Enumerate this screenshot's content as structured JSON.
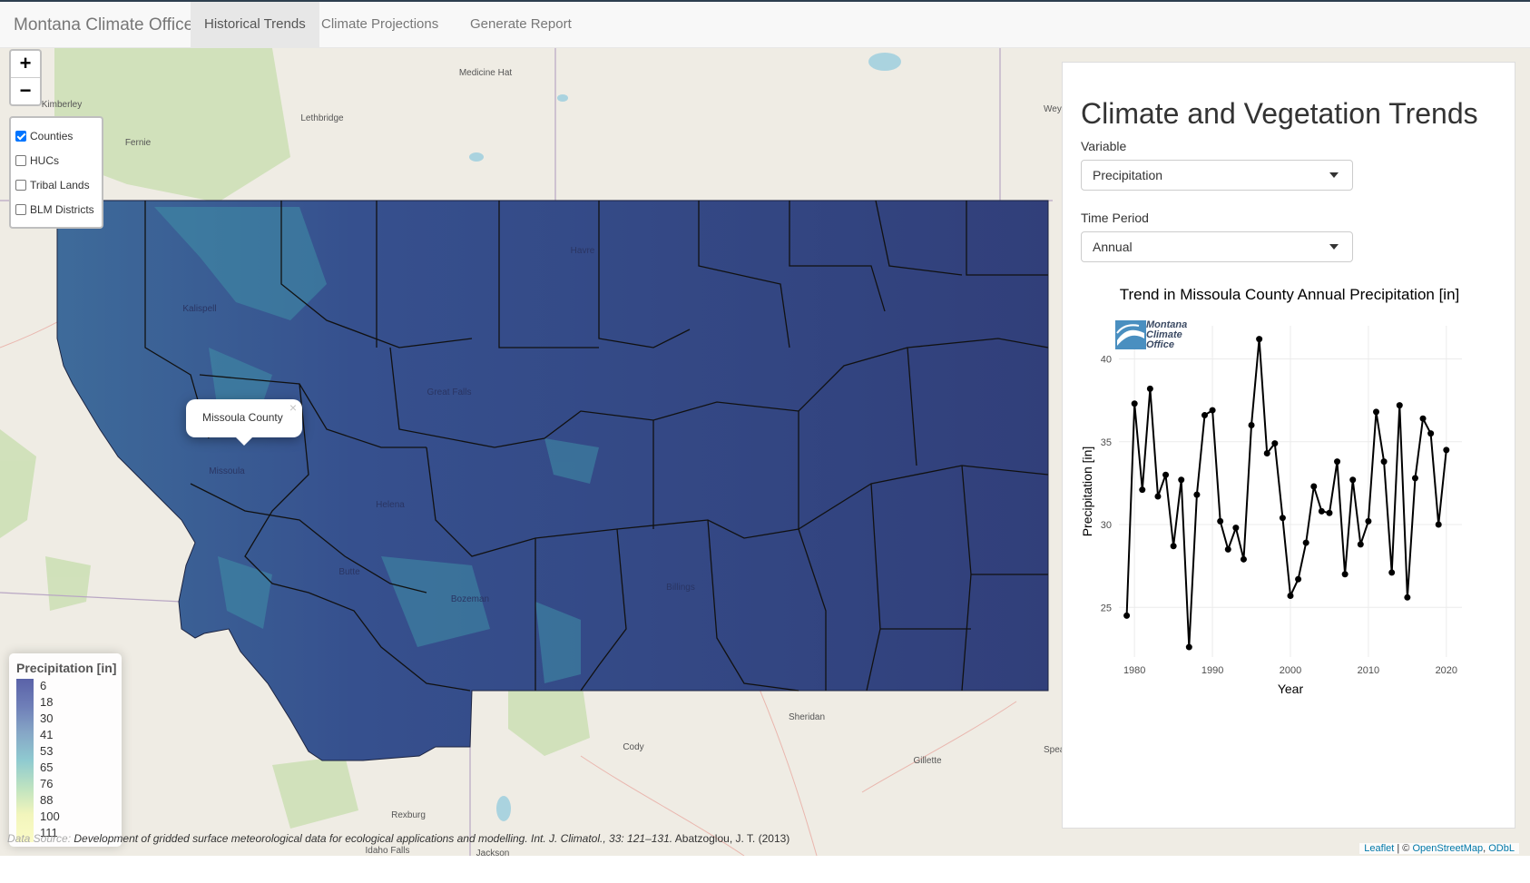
{
  "navbar": {
    "brand": "Montana Climate Office",
    "tabs": [
      {
        "label": "Historical Trends",
        "active": true
      },
      {
        "label": "Climate Projections",
        "active": false
      },
      {
        "label": "Generate Report",
        "active": false
      }
    ]
  },
  "map": {
    "zoom_in": "+",
    "zoom_out": "−",
    "layers": [
      {
        "label": "Counties",
        "checked": true
      },
      {
        "label": "HUCs",
        "checked": false
      },
      {
        "label": "Tribal Lands",
        "checked": false
      },
      {
        "label": "BLM Districts",
        "checked": false
      }
    ],
    "popup": {
      "text": "Missoula County",
      "close": "×"
    },
    "place_labels": [
      "Medicine Hat",
      "Lethbridge",
      "Kimberley",
      "Fernie",
      "Kalispell",
      "Great Falls",
      "Havre",
      "Missoula",
      "Helena",
      "Butte",
      "Bozeman",
      "Billings",
      "Sheridan",
      "Cody",
      "Gillette",
      "Rexburg",
      "Idaho Falls",
      "Jackson",
      "Wey",
      "Spea"
    ],
    "legend": {
      "title": "Precipitation [in]",
      "ticks": [
        "6",
        "18",
        "30",
        "41",
        "53",
        "65",
        "76",
        "88",
        "100",
        "111"
      ],
      "colors": [
        "#5a62a8",
        "#6f7fb8",
        "#86a6c6",
        "#8fcad0",
        "#bfe3c0",
        "#f2f5bc",
        "#fbfbc6"
      ]
    },
    "source_prefix": "Data Source: ",
    "source_italic": "Development of gridded surface meteorological data for ecological applications and modelling. Int. J. Climatol., 33: 121–131.",
    "source_author": "Abatzoglou, J. T. (2013)",
    "attribution": {
      "leaflet": "Leaflet",
      "sep": " | © ",
      "osm": "OpenStreetMap",
      "sep2": ", ",
      "odbl": "ODbL"
    }
  },
  "panel": {
    "title": "Climate and Vegetation Trends",
    "variable_label": "Variable",
    "variable_value": "Precipitation",
    "period_label": "Time Period",
    "period_value": "Annual",
    "chart_title": "Trend in Missoula County Annual Precipitation [in]",
    "logo_text": [
      "Montana",
      "Climate",
      "Office"
    ]
  },
  "chart_data": {
    "type": "line",
    "title": "Trend in Missoula County Annual Precipitation [in]",
    "xlabel": "Year",
    "ylabel": "Precipitation [in]",
    "x_ticks": [
      1980,
      1990,
      2000,
      2010,
      2020
    ],
    "y_ticks": [
      25,
      30,
      35,
      40
    ],
    "xlim": [
      1978,
      2022
    ],
    "ylim": [
      22,
      42
    ],
    "x": [
      1979,
      1980,
      1981,
      1982,
      1983,
      1984,
      1985,
      1986,
      1987,
      1988,
      1989,
      1990,
      1991,
      1992,
      1993,
      1994,
      1995,
      1996,
      1997,
      1998,
      1999,
      2000,
      2001,
      2002,
      2003,
      2004,
      2005,
      2006,
      2007,
      2008,
      2009,
      2010,
      2011,
      2012,
      2013,
      2014,
      2015,
      2016,
      2017,
      2018,
      2019,
      2020
    ],
    "values": [
      24.5,
      37.3,
      32.1,
      38.2,
      31.7,
      33.0,
      28.7,
      32.7,
      22.6,
      31.8,
      36.6,
      36.9,
      30.2,
      28.5,
      29.8,
      27.9,
      36.0,
      41.2,
      34.3,
      34.9,
      30.4,
      25.7,
      26.7,
      28.9,
      32.3,
      30.8,
      30.7,
      33.8,
      27.0,
      32.7,
      28.8,
      30.2,
      36.8,
      33.8,
      27.1,
      37.2,
      25.6,
      32.8,
      36.4,
      35.5,
      30.0,
      34.5
    ]
  }
}
